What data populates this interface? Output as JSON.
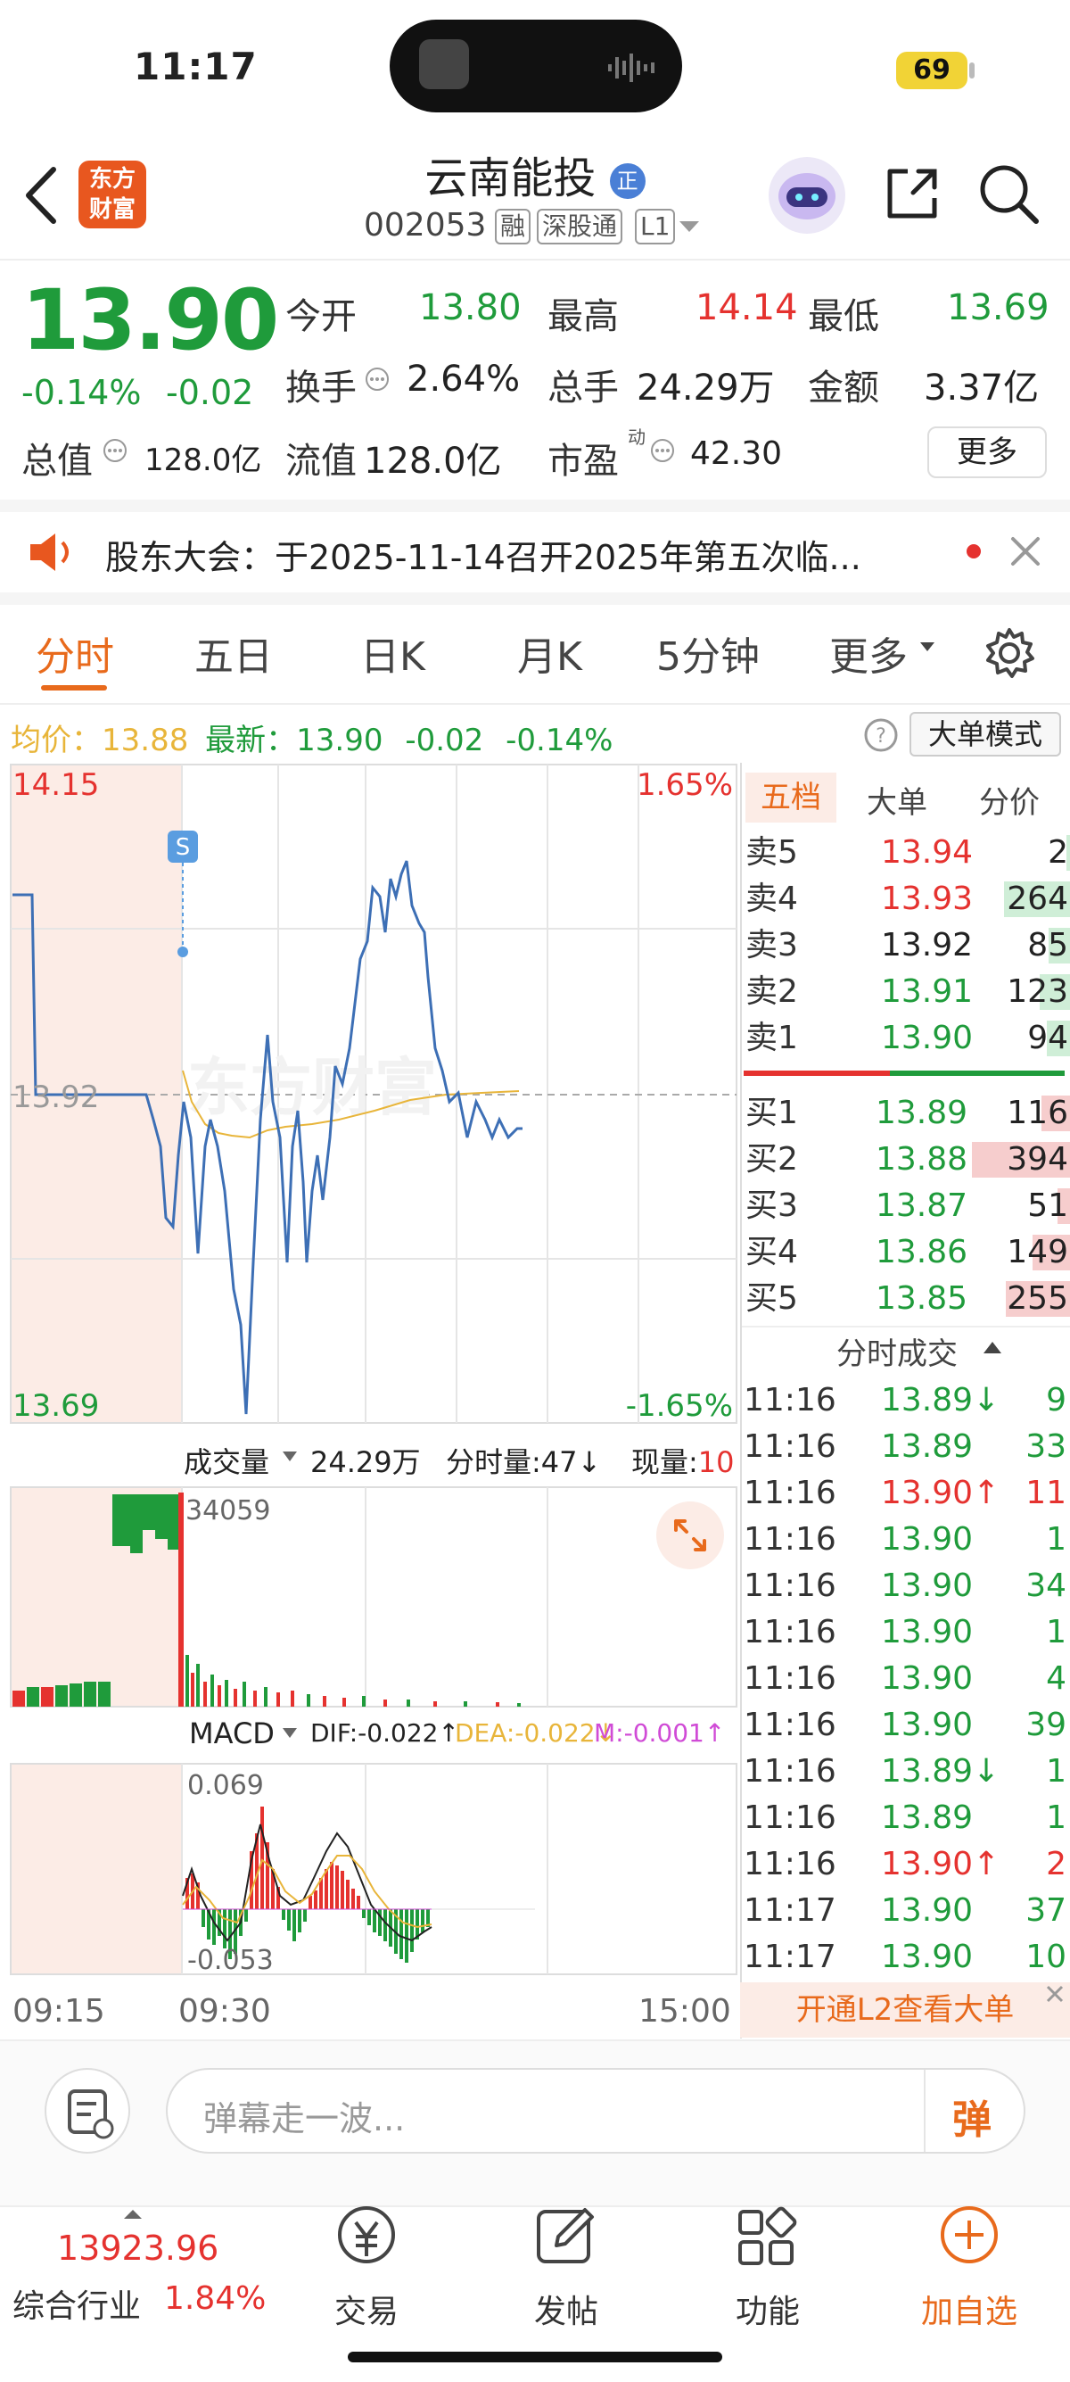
{
  "status_bar": {
    "time": "11:17",
    "battery": "69"
  },
  "header": {
    "logo_line1": "东方",
    "logo_line2": "财富",
    "stock_name": "云南能投",
    "name_badge": "正",
    "stock_code": "002053",
    "tags": [
      "融",
      "深股通",
      "L1"
    ]
  },
  "quote": {
    "price": "13.90",
    "change_pct": "-0.14%",
    "change": "-0.02",
    "open_label": "今开",
    "open": "13.80",
    "high_label": "最高",
    "high": "14.14",
    "low_label": "最低",
    "low": "13.69",
    "turnover_label": "换手",
    "turnover": "2.64%",
    "volume_label": "总手",
    "volume": "24.29万",
    "amount_label": "金额",
    "amount": "3.37亿",
    "mcap_label": "总值",
    "mcap": "128.0亿",
    "float_label": "流值",
    "float_cap": "128.0亿",
    "pe_label": "市盈",
    "pe_sup": "动",
    "pe": "42.30",
    "more_button": "更多"
  },
  "announcement": {
    "text": "股东大会：于2025-11-14召开2025年第五次临..."
  },
  "tabs": {
    "items": [
      "分时",
      "五日",
      "日K",
      "月K",
      "5分钟",
      "更多"
    ],
    "active": 0
  },
  "info_line": {
    "avg_label": "均价：",
    "avg": "13.88",
    "latest_label": "最新：",
    "latest": "13.90",
    "change": "-0.02",
    "change_pct": "-0.14%",
    "mode_button": "大单模式"
  },
  "chart": {
    "y_top": "14.15",
    "y_mid": "13.92",
    "y_bottom": "13.69",
    "pct_top": "1.65%",
    "pct_bottom": "-1.65%",
    "marker": "S",
    "watermark": "东方财富",
    "x_labels": [
      "09:15",
      "09:30",
      "15:00"
    ]
  },
  "volume_panel": {
    "label": "成交量",
    "total": "24.29万",
    "min_label": "分时量:",
    "min_value": "47",
    "now_label": "现量:",
    "now_value": "10",
    "max": "34059"
  },
  "macd_panel": {
    "label": "MACD",
    "dif": "DIF:-0.022↑",
    "dea": "DEA:-0.022↓",
    "m": "M:-0.001↑",
    "top": "0.069",
    "bottom": "-0.053"
  },
  "orderbook": {
    "tabs": [
      "五档",
      "大单",
      "分价"
    ],
    "asks": [
      {
        "label": "卖5",
        "price": "13.94",
        "vol": "2",
        "fill": 0.01
      },
      {
        "label": "卖4",
        "price": "13.93",
        "vol": "264",
        "fill": 0.67
      },
      {
        "label": "卖3",
        "price": "13.92",
        "vol": "85",
        "fill": 0.22
      },
      {
        "label": "卖2",
        "price": "13.91",
        "vol": "123",
        "fill": 0.31
      },
      {
        "label": "卖1",
        "price": "13.90",
        "vol": "94",
        "fill": 0.24
      }
    ],
    "bids": [
      {
        "label": "买1",
        "price": "13.89",
        "vol": "116",
        "fill": 0.29
      },
      {
        "label": "买2",
        "price": "13.88",
        "vol": "394",
        "fill": 1.0
      },
      {
        "label": "买3",
        "price": "13.87",
        "vol": "51",
        "fill": 0.13
      },
      {
        "label": "买4",
        "price": "13.86",
        "vol": "149",
        "fill": 0.38
      },
      {
        "label": "买5",
        "price": "13.85",
        "vol": "255",
        "fill": 0.65
      }
    ]
  },
  "ticks": {
    "title": "分时成交",
    "rows": [
      {
        "time": "11:16",
        "price": "13.89↓",
        "vol": "9"
      },
      {
        "time": "11:16",
        "price": "13.89",
        "vol": "33"
      },
      {
        "time": "11:16",
        "price": "13.90↑",
        "vol": "11"
      },
      {
        "time": "11:16",
        "price": "13.90",
        "vol": "1"
      },
      {
        "time": "11:16",
        "price": "13.90",
        "vol": "34"
      },
      {
        "time": "11:16",
        "price": "13.90",
        "vol": "1"
      },
      {
        "time": "11:16",
        "price": "13.90",
        "vol": "4"
      },
      {
        "time": "11:16",
        "price": "13.90",
        "vol": "39"
      },
      {
        "time": "11:16",
        "price": "13.89↓",
        "vol": "1"
      },
      {
        "time": "11:16",
        "price": "13.89",
        "vol": "1"
      },
      {
        "time": "11:16",
        "price": "13.90↑",
        "vol": "2"
      },
      {
        "time": "11:17",
        "price": "13.90",
        "vol": "37"
      },
      {
        "time": "11:17",
        "price": "13.90",
        "vol": "10"
      }
    ],
    "l2_banner": "开通L2查看大单"
  },
  "comment_bar": {
    "placeholder": "弹幕走一波...",
    "danmu_button": "弹"
  },
  "bottom_bar": {
    "index_value": "13923.96",
    "index_name": "综合行业",
    "index_pct": "1.84%",
    "items": [
      "交易",
      "发帖",
      "功能",
      "加自选"
    ]
  },
  "colors": {
    "up": "#e5322f",
    "down": "#1f9b3b",
    "accent": "#e86a1c",
    "line": "#3d6fb5",
    "avg": "#e8b53a"
  }
}
